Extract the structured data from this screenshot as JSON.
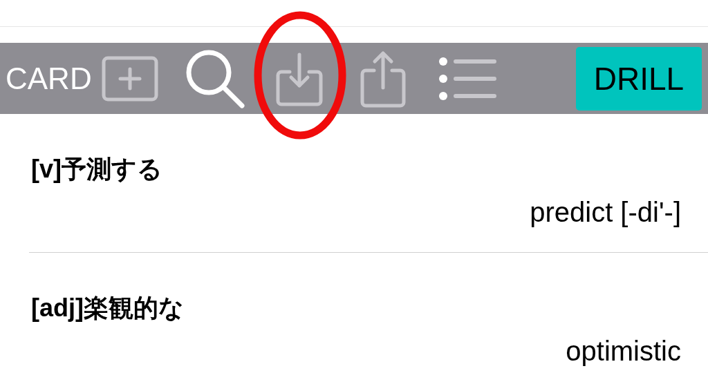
{
  "toolbar": {
    "card_label": "CARD",
    "drill_button": "DRILL"
  },
  "words": [
    {
      "meaning": "[v]予測する",
      "term": "predict [-di'-]"
    },
    {
      "meaning": "[adj]楽観的な",
      "term": "optimistic"
    }
  ]
}
